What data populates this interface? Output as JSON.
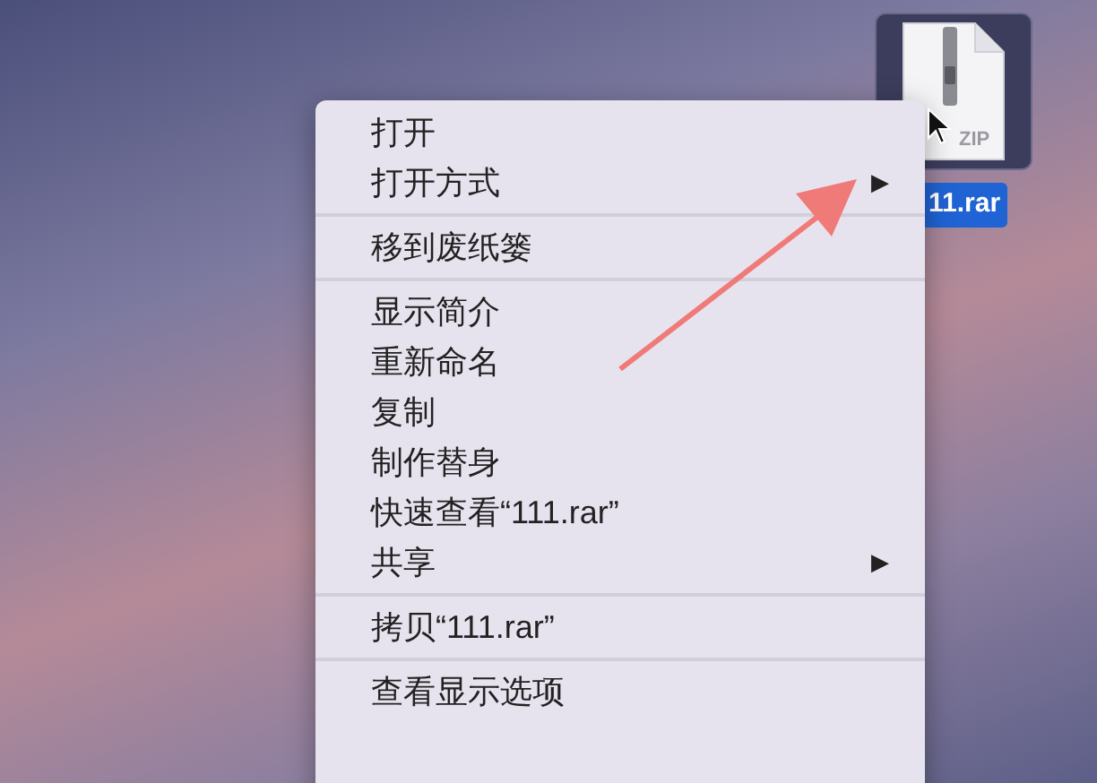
{
  "file_icon": {
    "caption": "11.rar",
    "badge": "ZIP"
  },
  "context_menu": {
    "groups": [
      [
        {
          "label": "打开"
        },
        {
          "label": "打开方式",
          "arrow": "▶"
        }
      ],
      [
        {
          "label": "移到废纸篓"
        }
      ],
      [
        {
          "label": "显示简介"
        },
        {
          "label": "重新命名"
        },
        {
          "label": "复制"
        },
        {
          "label": "制作替身"
        },
        {
          "label": "快速查看“111.rar”"
        },
        {
          "label": "共享",
          "arrow": "▶"
        }
      ],
      [
        {
          "label": "拷贝“111.rar”"
        }
      ],
      [
        {
          "label": "查看显示选项"
        }
      ]
    ]
  }
}
